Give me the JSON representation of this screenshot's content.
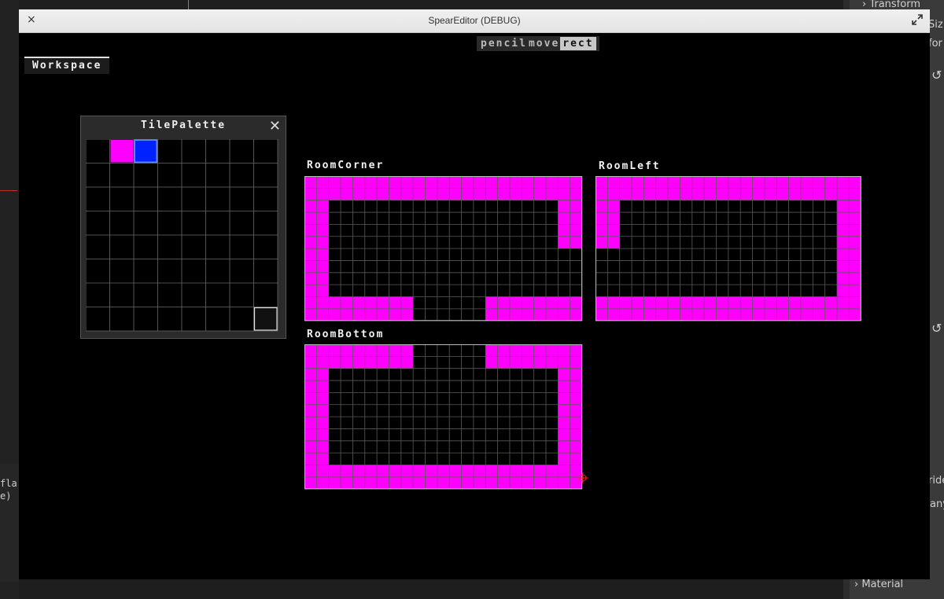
{
  "background": {
    "right_panel": {
      "transform_label": "Transform",
      "sizing_label": "Sizi",
      "for_label": "for",
      "override_label": "ride",
      "any_label": "any",
      "material_label": "Material"
    },
    "left_console": {
      "line1": "fla",
      "line2": "e)"
    }
  },
  "window": {
    "title": "SpearEditor (DEBUG)",
    "close_glyph": "×"
  },
  "toolbar": {
    "tools": [
      "pencil",
      "move",
      "rect"
    ],
    "active_tool": "rect"
  },
  "workspace": {
    "label": "Workspace"
  },
  "palette": {
    "title": "TilePalette",
    "close_glyph": "✕",
    "cols": 8,
    "rows": 8,
    "tiles": [
      {
        "col": 1,
        "row": 0,
        "color": "#ff00ff"
      },
      {
        "col": 2,
        "row": 0,
        "color": "#0022ff",
        "selected": true
      }
    ],
    "highlight": {
      "col": 7,
      "row": 7
    }
  },
  "colors": {
    "magenta": "#ff00ff",
    "grid": "#5a5a5a",
    "blue": "#0022ff"
  },
  "rooms": [
    {
      "name": "RoomCorner",
      "cols": 23,
      "rows": 12,
      "rects": [
        [
          0,
          0,
          23,
          2
        ],
        [
          0,
          0,
          2,
          12
        ],
        [
          21,
          0,
          2,
          6
        ],
        [
          0,
          10,
          9,
          2
        ],
        [
          15,
          10,
          8,
          2
        ]
      ]
    },
    {
      "name": "RoomLeft",
      "cols": 22,
      "rows": 12,
      "rects": [
        [
          0,
          0,
          22,
          2
        ],
        [
          0,
          0,
          2,
          6
        ],
        [
          20,
          0,
          2,
          12
        ],
        [
          0,
          10,
          22,
          2
        ]
      ]
    },
    {
      "name": "RoomBottom",
      "cols": 23,
      "rows": 12,
      "rects": [
        [
          0,
          0,
          9,
          2
        ],
        [
          15,
          0,
          8,
          2
        ],
        [
          0,
          0,
          2,
          12
        ],
        [
          21,
          0,
          2,
          12
        ],
        [
          0,
          10,
          23,
          2
        ]
      ]
    }
  ]
}
